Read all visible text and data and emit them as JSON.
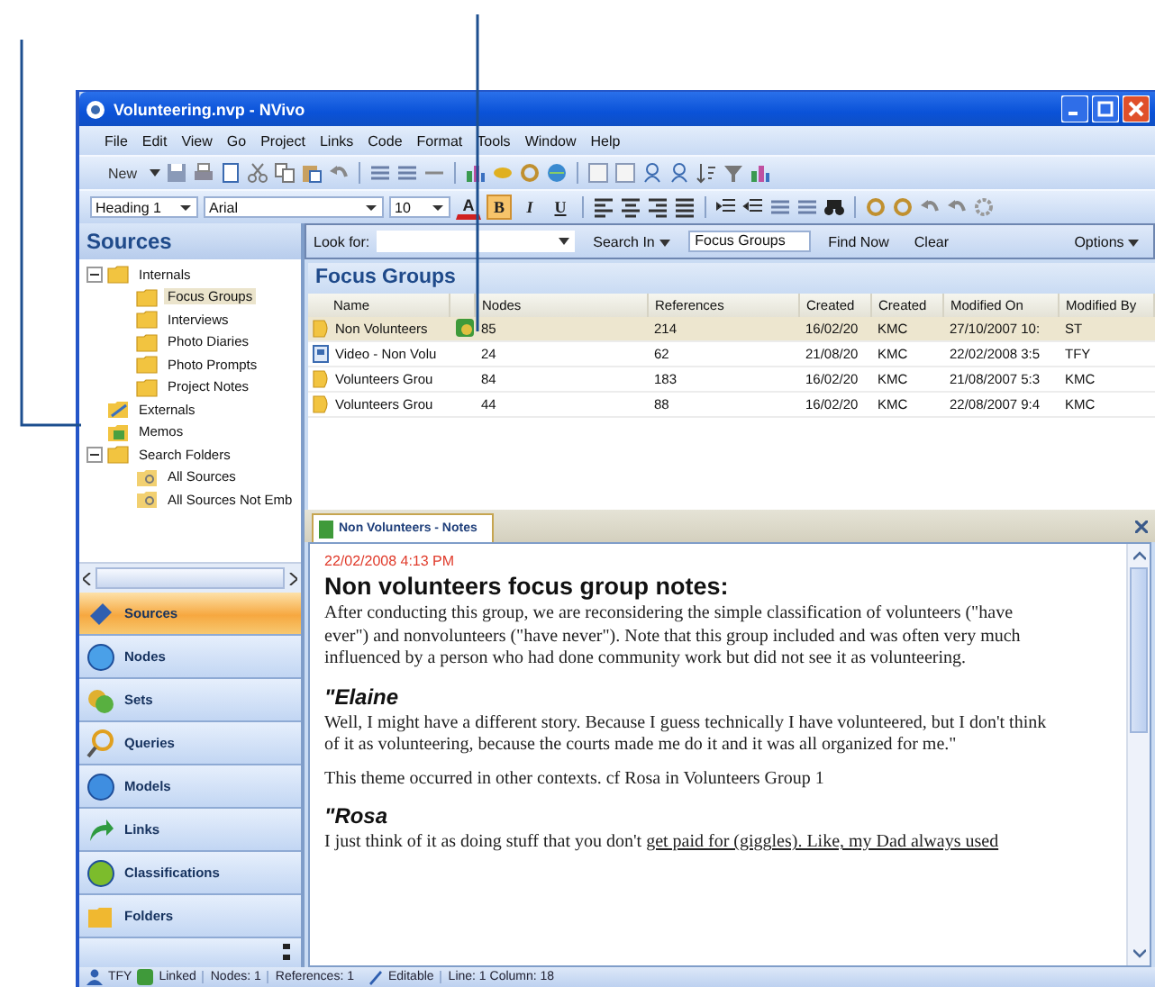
{
  "window": {
    "title": "Volunteering.nvp - NVivo"
  },
  "menu": [
    "File",
    "Edit",
    "View",
    "Go",
    "Project",
    "Links",
    "Code",
    "Format",
    "Tools",
    "Window",
    "Help"
  ],
  "toolbar": {
    "new_button": "New"
  },
  "format_toolbar": {
    "style": "Heading 1",
    "font": "Arial",
    "size": "10",
    "font_color": "A",
    "buttons": [
      {
        "label": "B",
        "kind": "bold",
        "selected": true
      },
      {
        "label": "I",
        "kind": "italic",
        "selected": false
      },
      {
        "label": "U",
        "kind": "underline",
        "selected": false
      }
    ]
  },
  "sidebar": {
    "title": "Sources",
    "tree": [
      {
        "label": "Internals",
        "kind": "folder",
        "selected": false,
        "expanded": true,
        "children": [
          {
            "label": "Focus Groups",
            "kind": "folder",
            "selected": true
          },
          {
            "label": "Interviews",
            "kind": "folder",
            "selected": false
          },
          {
            "label": "Photo Diaries",
            "kind": "folder",
            "selected": false
          },
          {
            "label": "Photo Prompts",
            "kind": "folder",
            "selected": false
          },
          {
            "label": "Project Notes",
            "kind": "folder",
            "selected": false
          }
        ]
      },
      {
        "label": "Externals",
        "kind": "externals",
        "selected": false
      },
      {
        "label": "Memos",
        "kind": "memos",
        "selected": false
      },
      {
        "label": "Search Folders",
        "kind": "folder",
        "selected": false,
        "expanded": true,
        "children": [
          {
            "label": "All Sources",
            "kind": "search",
            "selected": false
          },
          {
            "label": "All Sources Not Emb",
            "kind": "search",
            "selected": false
          }
        ]
      }
    ],
    "nav": [
      {
        "label": "Sources",
        "kind": "sources",
        "selected": true
      },
      {
        "label": "Nodes",
        "kind": "nodes",
        "selected": false
      },
      {
        "label": "Sets",
        "kind": "sets",
        "selected": false
      },
      {
        "label": "Queries",
        "kind": "queries",
        "selected": false
      },
      {
        "label": "Models",
        "kind": "models",
        "selected": false
      },
      {
        "label": "Links",
        "kind": "links",
        "selected": false
      },
      {
        "label": "Classifications",
        "kind": "classifications",
        "selected": false
      },
      {
        "label": "Folders",
        "kind": "folders",
        "selected": false
      }
    ]
  },
  "find_bar": {
    "look_for": "Look for:",
    "search_in": "Search In",
    "search_in_value": "Focus Groups",
    "find_now": "Find Now",
    "clear": "Clear",
    "options": "Options"
  },
  "list": {
    "title": "Focus Groups",
    "columns": [
      "Name",
      "Nodes",
      "References",
      "Created",
      "Created",
      "Modified On",
      "Modified By"
    ],
    "rows": [
      {
        "kind": "document",
        "name": "Non Volunteers",
        "linked": true,
        "selected": true,
        "nodes": "85",
        "references": "214",
        "created_on": "16/02/20",
        "created_by": "KMC",
        "modified_on": "27/10/2007 10:",
        "modified_by": "ST"
      },
      {
        "kind": "video",
        "name": "Video - Non Volu",
        "linked": false,
        "selected": false,
        "nodes": "24",
        "references": "62",
        "created_on": "21/08/20",
        "created_by": "KMC",
        "modified_on": "22/02/2008 3:5",
        "modified_by": "TFY"
      },
      {
        "kind": "document",
        "name": "Volunteers Grou",
        "linked": false,
        "selected": false,
        "nodes": "84",
        "references": "183",
        "created_on": "16/02/20",
        "created_by": "KMC",
        "modified_on": "21/08/2007 5:3",
        "modified_by": "KMC"
      },
      {
        "kind": "document",
        "name": "Volunteers Grou",
        "linked": false,
        "selected": false,
        "nodes": "44",
        "references": "88",
        "created_on": "16/02/20",
        "created_by": "KMC",
        "modified_on": "22/08/2007 9:4",
        "modified_by": "KMC"
      }
    ]
  },
  "editor": {
    "tab": "Non Volunteers - Notes",
    "date": "22/02/2008 4:13 PM",
    "blocks": [
      {
        "kind": "heading",
        "text": "Non volunteers focus group notes:"
      },
      {
        "kind": "paragraph",
        "text": "After conducting this group, we are reconsidering the simple classification of volunteers (\"have ever\") and nonvolunteers (\"have never\"). Note that this group included and was often very much influenced by a person who had done community work but did not see it as volunteering."
      },
      {
        "kind": "quote_heading",
        "text": "\"Elaine"
      },
      {
        "kind": "paragraph",
        "text": "Well, I might have a different story. Because I guess technically I have volunteered, but I don't think of it as volunteering, because the courts made me do it and it was all organized for me.\""
      },
      {
        "kind": "paragraph",
        "text": "This theme occurred in other contexts. cf Rosa in Volunteers Group 1"
      },
      {
        "kind": "quote_heading",
        "text": "\"Rosa"
      },
      {
        "kind": "marked_paragraph",
        "segments": [
          {
            "text": "I just think of it as doing stuff that you don't ",
            "underlined": false
          },
          {
            "text": "get paid for (giggles). Like, my Dad always used",
            "underlined": true
          }
        ]
      }
    ]
  },
  "status_bar": {
    "user": "TFY",
    "link_state": "Linked",
    "nodes": "Nodes: 1",
    "references": "References: 1",
    "edit_state": "Editable",
    "position": "Line: 1 Column: 18"
  }
}
